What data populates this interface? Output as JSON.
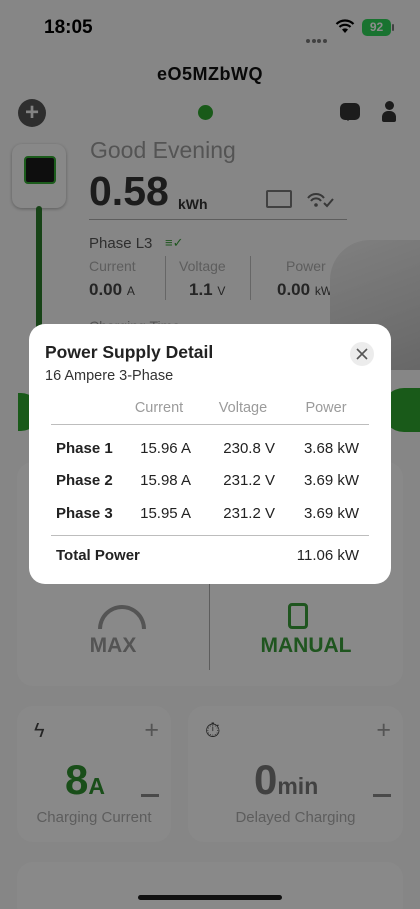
{
  "status_bar": {
    "time": "18:05",
    "battery": "92"
  },
  "header": {
    "device_name": "eO5MZbWQ"
  },
  "dashboard": {
    "greeting": "Good Evening",
    "energy_value": "0.58",
    "energy_unit": "kWh",
    "phase_label": "Phase L3",
    "metrics": [
      {
        "label": "Current",
        "value": "0.00",
        "unit": "A"
      },
      {
        "label": "Voltage",
        "value": "1.1",
        "unit": "V"
      },
      {
        "label": "Power",
        "value": "0.00",
        "unit": "kW"
      }
    ],
    "charging_time_label": "Charging Time"
  },
  "modes": {
    "max_label": "MAX",
    "manual_label": "MANUAL"
  },
  "cards": {
    "charging_current": {
      "value": "8",
      "unit": "A",
      "caption": "Charging Current"
    },
    "delayed_charging": {
      "value": "0",
      "unit": "min",
      "caption": "Delayed Charging"
    }
  },
  "modal": {
    "title": "Power Supply Detail",
    "subtitle": "16 Ampere 3-Phase",
    "columns": [
      "Current",
      "Voltage",
      "Power"
    ],
    "rows": [
      {
        "phase": "Phase 1",
        "current": "15.96 A",
        "voltage": "230.8 V",
        "power": "3.68 kW"
      },
      {
        "phase": "Phase 2",
        "current": "15.98 A",
        "voltage": "231.2 V",
        "power": "3.69 kW"
      },
      {
        "phase": "Phase 3",
        "current": "15.95 A",
        "voltage": "231.2 V",
        "power": "3.69 kW"
      }
    ],
    "total_label": "Total Power",
    "total_value": "11.06 kW"
  },
  "colors": {
    "accent_green": "#3a9b3a",
    "online_dot": "#2fa52f",
    "battery": "#2fd158"
  },
  "icons": [
    "plus-icon",
    "chat-icon",
    "user-icon",
    "card-reader-icon",
    "wifi-check-icon",
    "lightning-icon",
    "timer-icon",
    "close-icon"
  ]
}
